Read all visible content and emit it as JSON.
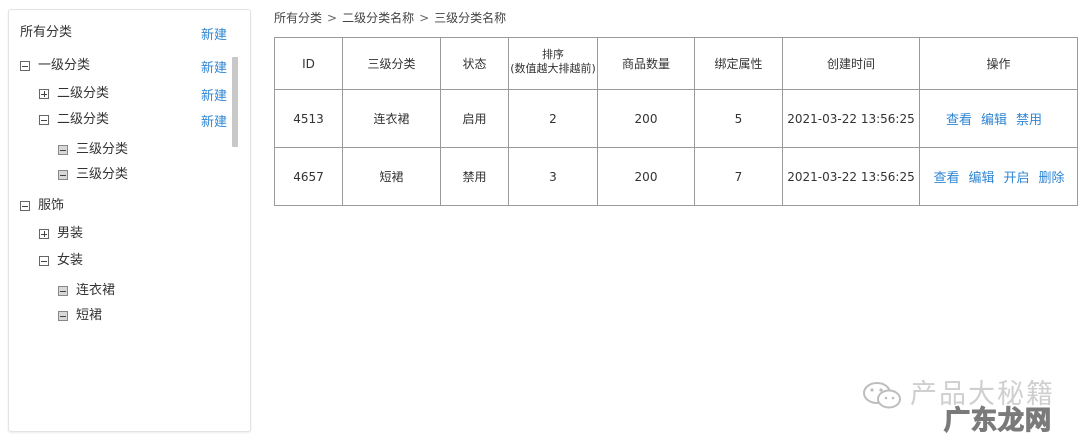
{
  "sidebar": {
    "header_label": "所有分类",
    "header_new": "新建",
    "rows": [
      {
        "label": "一级分类",
        "new": "新建"
      },
      {
        "label": "二级分类",
        "new": "新建"
      },
      {
        "label": "二级分类",
        "new": "新建"
      },
      {
        "label": "三级分类"
      },
      {
        "label": "三级分类"
      },
      {
        "label": "服饰"
      },
      {
        "label": "男装"
      },
      {
        "label": "女装"
      },
      {
        "label": "连衣裙"
      },
      {
        "label": "短裙"
      }
    ]
  },
  "breadcrumb": [
    "所有分类",
    "二级分类名称",
    "三级分类名称"
  ],
  "breadcrumb_sep": ">",
  "table": {
    "headers": [
      "ID",
      "三级分类",
      "状态",
      "排序\n(数值越大排越前)",
      "商品数量",
      "绑定属性",
      "创建时间",
      "操作"
    ],
    "rows": [
      {
        "id": "4513",
        "name": "连衣裙",
        "status": "启用",
        "sort": "2",
        "count": "200",
        "attrs": "5",
        "created": "2021-03-22 13:56:25",
        "ops": [
          "查看",
          "编辑",
          "禁用"
        ]
      },
      {
        "id": "4657",
        "name": "短裙",
        "status": "禁用",
        "sort": "3",
        "count": "200",
        "attrs": "7",
        "created": "2021-03-22 13:56:25",
        "ops": [
          "查看",
          "编辑",
          "开启",
          "删除"
        ]
      }
    ]
  },
  "watermark": {
    "line1": "产品大秘籍",
    "line2": "广东龙网"
  },
  "colors": {
    "link": "#2f86d4",
    "border": "#9a9a9a"
  }
}
